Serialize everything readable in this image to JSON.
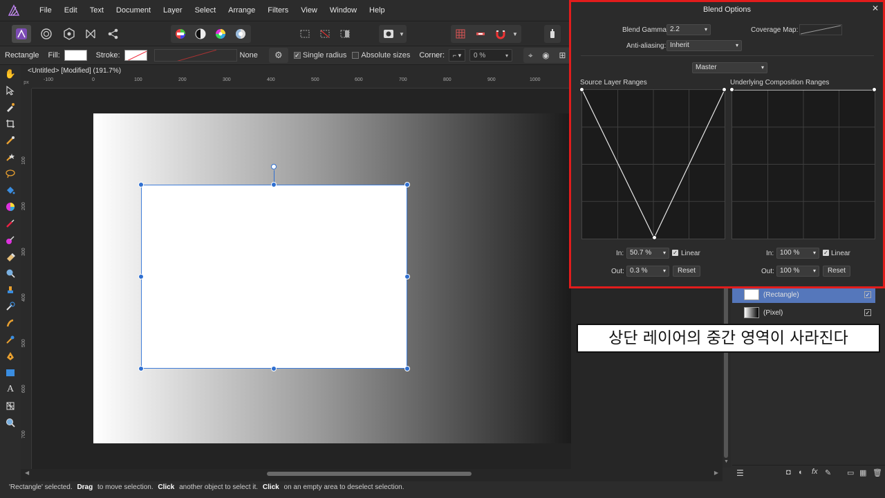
{
  "menu": [
    "File",
    "Edit",
    "Text",
    "Document",
    "Layer",
    "Select",
    "Arrange",
    "Filters",
    "View",
    "Window",
    "Help"
  ],
  "context": {
    "tool": "Rectangle",
    "fill_label": "Fill:",
    "stroke_label": "Stroke:",
    "stroke_value": "None",
    "single_radius": "Single radius",
    "absolute_sizes": "Absolute sizes",
    "corner_label": "Corner:",
    "corner_value": "0 %"
  },
  "document": {
    "title": "<Untitled> [Modified] (191.7%)",
    "ruler_unit": "px",
    "ruler_h": [
      "-100",
      "0",
      "100",
      "200",
      "300",
      "400",
      "500",
      "600",
      "700",
      "800",
      "900",
      "1000"
    ],
    "ruler_v": [
      "100",
      "200",
      "300",
      "400",
      "500",
      "600",
      "700"
    ]
  },
  "dialog": {
    "title": "Blend Options",
    "blend_gamma_label": "Blend Gamma:",
    "blend_gamma": "2.2",
    "coverage_map_label": "Coverage Map:",
    "antialiasing_label": "Anti-aliasing:",
    "antialiasing": "Inherit",
    "channel": "Master",
    "source": {
      "label": "Source Layer Ranges",
      "in_label": "In:",
      "in": "50.7 %",
      "out_label": "Out:",
      "out": "0.3 %",
      "linear": "Linear",
      "reset": "Reset"
    },
    "underlying": {
      "label": "Underlying Composition Ranges",
      "in_label": "In:",
      "in": "100 %",
      "out_label": "Out:",
      "out": "100 %",
      "linear": "Linear",
      "reset": "Reset"
    }
  },
  "layers": [
    {
      "name": "(Rectangle)",
      "selected": true
    },
    {
      "name": "(Pixel)",
      "selected": false
    }
  ],
  "caption": "상단 레이어의 중간 영역이 사라진다",
  "status": {
    "quoted": "'Rectangle' selected.",
    "drag": "Drag",
    "drag_text": "to move selection.",
    "click1": "Click",
    "click1_text": "another object to select it.",
    "click2": "Click",
    "click2_text": "on an empty area to deselect selection."
  },
  "colors": {
    "accent": "#2f6fd0",
    "highlight_border": "#e21c1c",
    "layer_selected": "#5577bb"
  }
}
